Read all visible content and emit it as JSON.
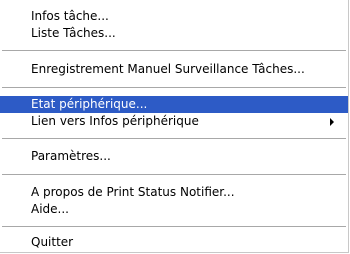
{
  "menu": {
    "items": [
      {
        "label": "Infos tâche..."
      },
      {
        "label": "Liste Tâches..."
      },
      {
        "label": "Enregistrement Manuel Surveillance Tâches..."
      },
      {
        "label": "Etat périphérique..."
      },
      {
        "label": "Lien vers Infos périphérique"
      },
      {
        "label": "Paramètres..."
      },
      {
        "label": "A propos de Print Status Notifier..."
      },
      {
        "label": "Aide..."
      },
      {
        "label": "Quitter"
      }
    ],
    "highlight_color": "#2d5bc6"
  }
}
